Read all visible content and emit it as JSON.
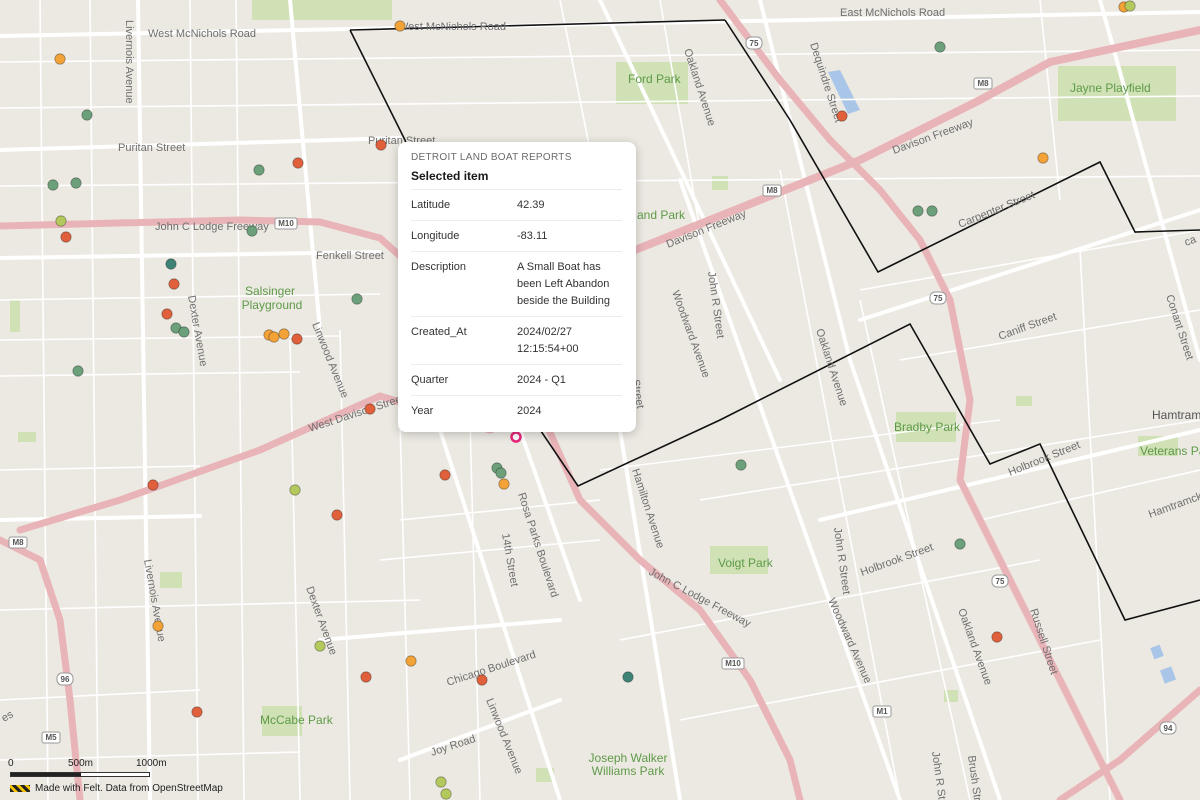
{
  "popup": {
    "layer_name": "DETROIT LAND BOAT REPORTS",
    "title": "Selected item",
    "rows": [
      {
        "key": "Latitude",
        "value": "42.39"
      },
      {
        "key": "Longitude",
        "value": "-83.11"
      },
      {
        "key": "Description",
        "value": "A Small Boat has been Left Abandon beside the Building"
      },
      {
        "key": "Created_At",
        "value": "2024/02/27 12:15:54+00"
      },
      {
        "key": "Quarter",
        "value": "2024 - Q1"
      },
      {
        "key": "Year",
        "value": "2024"
      }
    ]
  },
  "map": {
    "streets": {
      "w_mcnichols": "West McNichols Road",
      "w_mcnichols_2": "West McNichols Road",
      "e_mcnichols": "East McNichols Road",
      "puritan": "Puritan Street",
      "puritan_2": "Puritan Street",
      "jc_lodge_fwy": "John C Lodge Freeway",
      "fenkell": "Fenkell Street",
      "w_davison": "West Davison Street",
      "davison_fwy": "Davison Freeway",
      "davison_fwy_2": "Davison Freeway",
      "jc_lodge_fwy_2": "John C Lodge Freeway",
      "livernois": "Livernois Avenue",
      "livernois_2": "Livernois Avenue",
      "dexter": "Dexter Avenue",
      "dexter_2": "Dexter Avenue",
      "linwood": "Linwood Avenue",
      "linwood_2": "Linwood Avenue",
      "oakland": "Oakland Avenue",
      "oakland_2": "Oakland Avenue",
      "oakland_3": "Oakland Avenue",
      "woodward": "Woodward Avenue",
      "woodward_2": "Woodward Avenue",
      "jr_r": "John R Street",
      "jr_r_2": "John R Street",
      "jr_r_3": "John R Street",
      "hamilton": "Hamilton Avenue",
      "rosa_parks": "Rosa Parks Boulevard",
      "fourteenth": "14th Street",
      "chicago": "Chicago Boulevard",
      "joy": "Joy Road",
      "caniff": "Caniff Street",
      "carpenter": "Carpenter Street",
      "holbrook": "Holbrook Street",
      "holbrook_2": "Holbrook Street",
      "russell": "Russell Street",
      "brush": "Brush Street",
      "conant": "Conant Street",
      "dequindre": "Dequindre Street",
      "partial_street": "Street",
      "partial_and_park": "and Park",
      "partial_hamtramck": "Hamtramck"
    },
    "parks": {
      "ford_park": "Ford Park",
      "jayne": "Jayne Playfield",
      "salsinger": "Salsinger Playground",
      "bradby": "Bradby Park",
      "voigt": "Voigt Park",
      "mccabe": "McCabe Park",
      "joseph_walker": "Joseph Walker Williams Park",
      "veterans": "Veterans Park"
    },
    "areas": {
      "hamtramck": "Hamtram"
    },
    "shields": {
      "i75_a": "75",
      "i75_b": "75",
      "i75_c": "75",
      "m8_a": "M8",
      "m8_b": "M8",
      "m8_c": "M8",
      "m10_a": "M10",
      "m10_b": "M10",
      "m1": "M1",
      "m5": "M5",
      "i96": "96",
      "i94": "94"
    },
    "colors": {
      "red": "#e0603c",
      "orange": "#f2a236",
      "lime": "#b3c95c",
      "green": "#6ba07a",
      "teal": "#3f8276",
      "selected": "#e8267a"
    }
  },
  "scale": {
    "zero": "0",
    "mid": "500m",
    "max": "1000m"
  },
  "attribution": "Made with Felt. Data from OpenStreetMap"
}
